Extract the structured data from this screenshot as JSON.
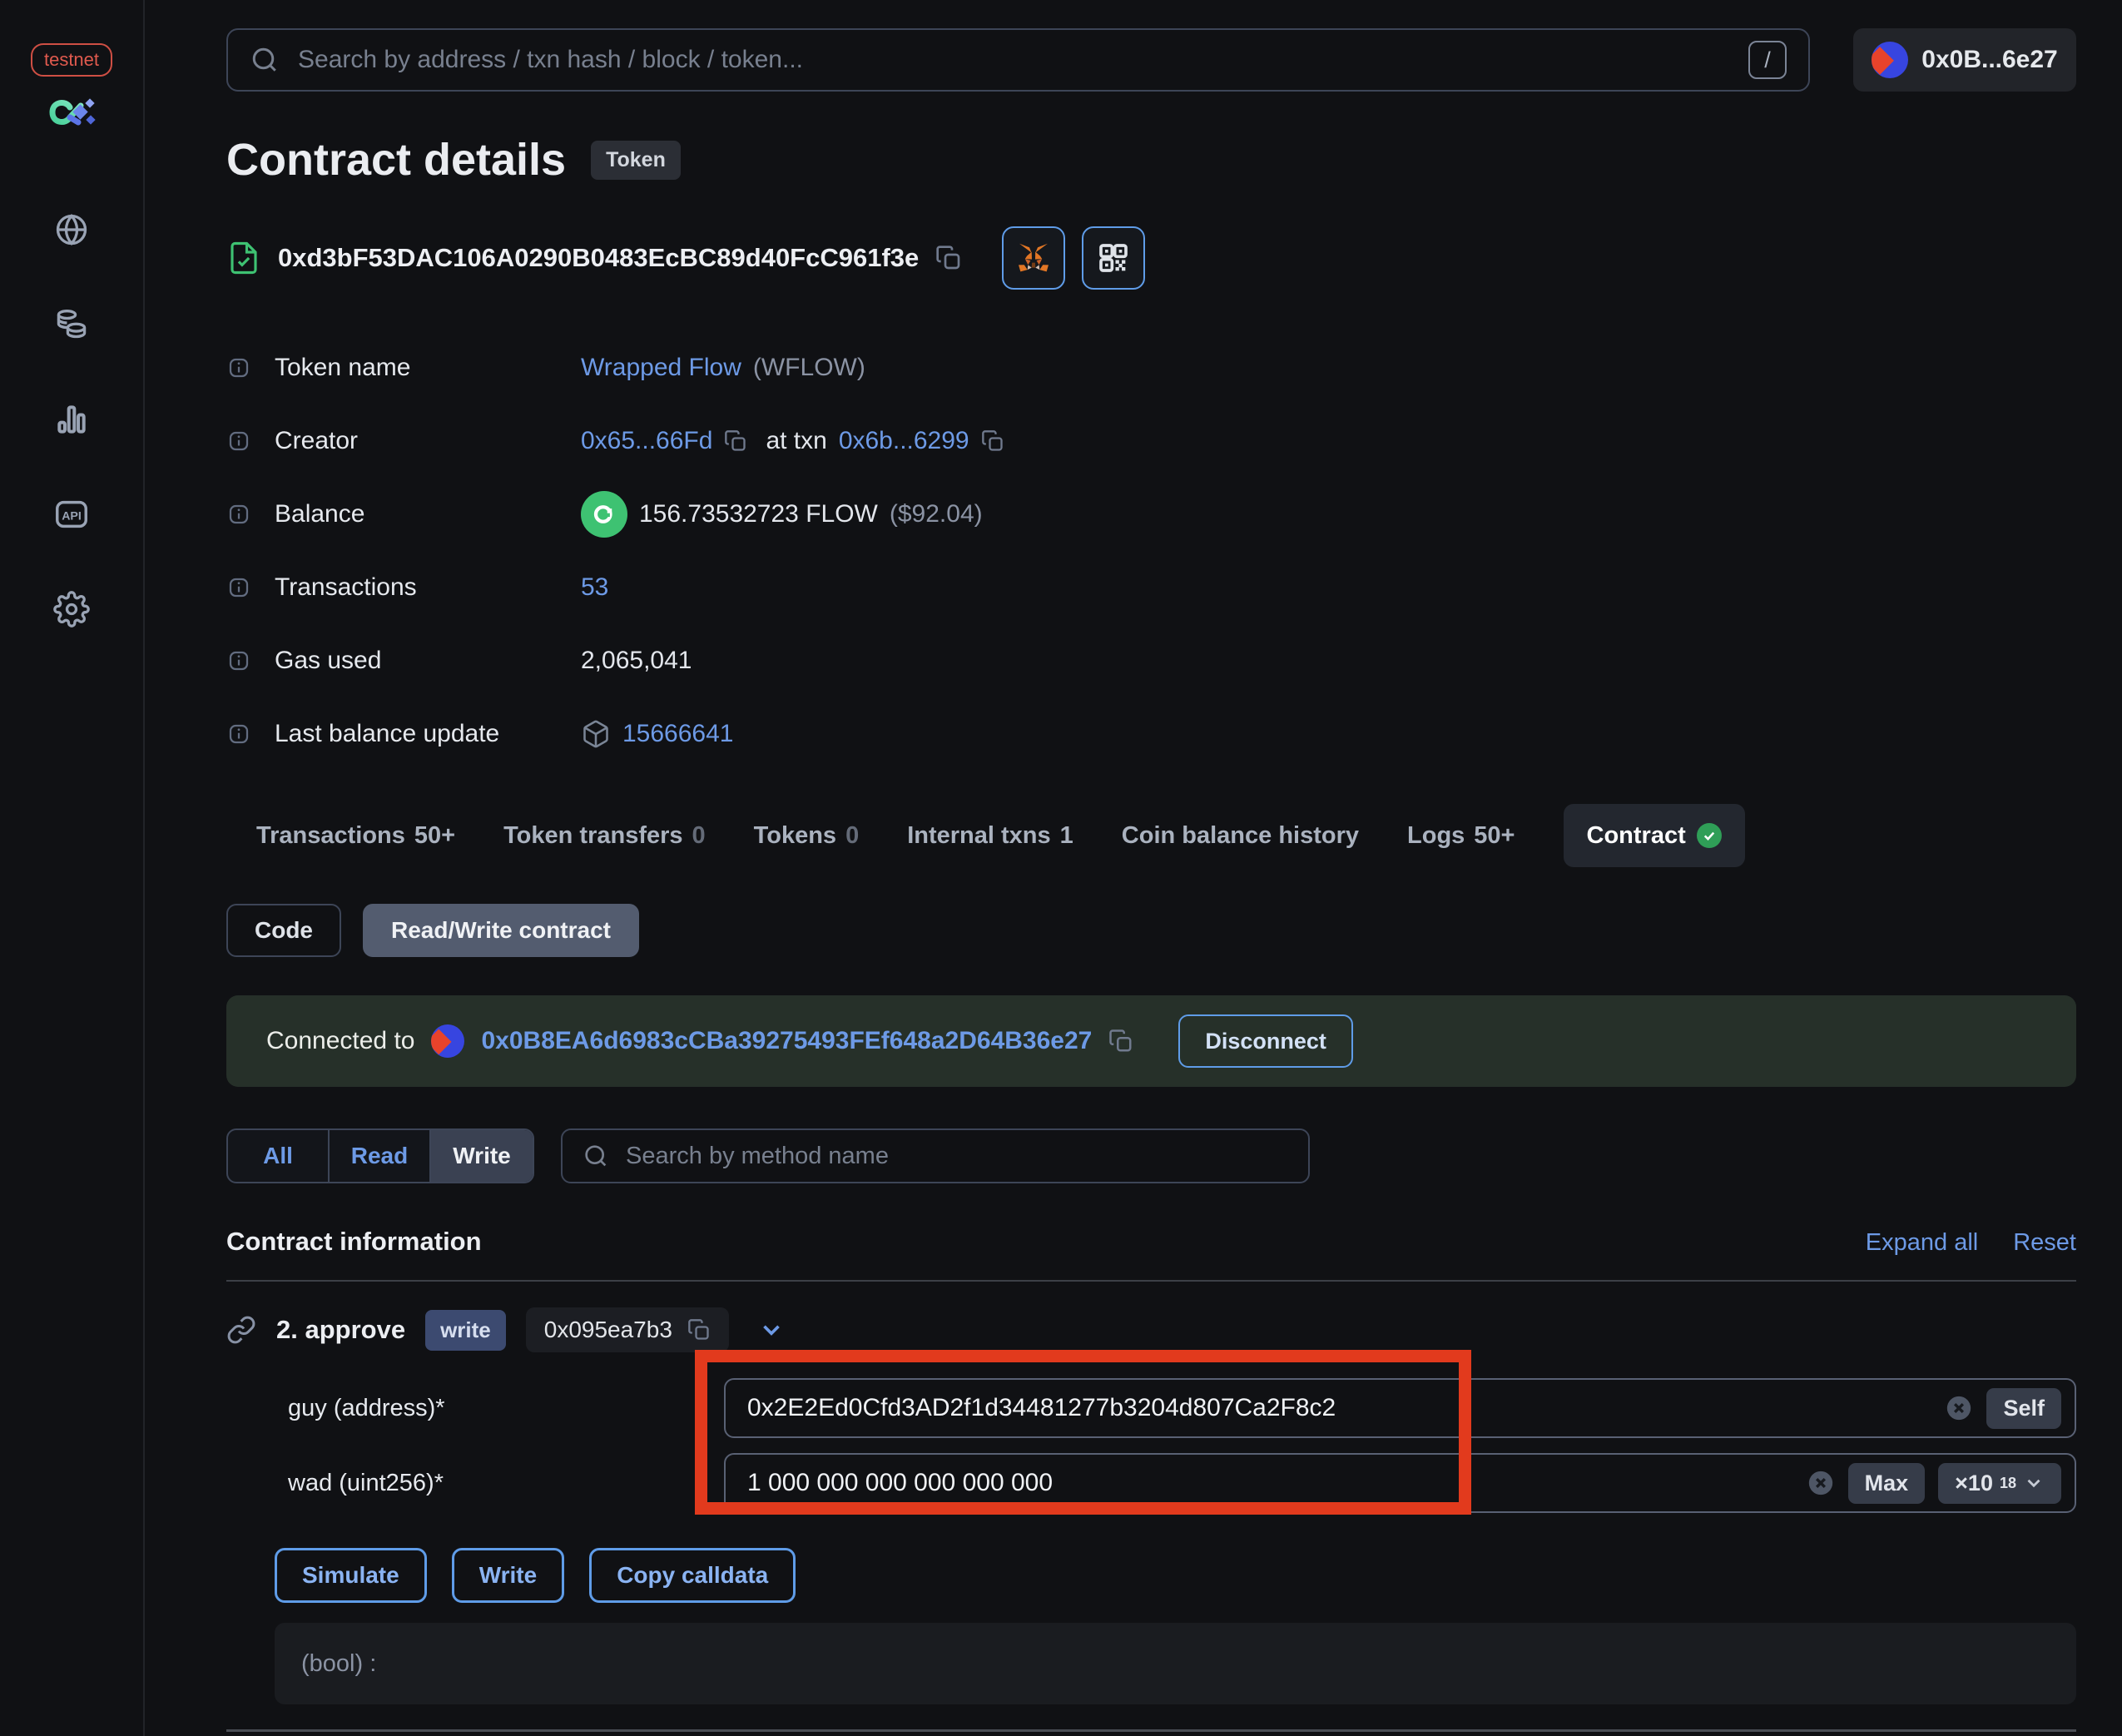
{
  "app": {
    "env_badge": "testnet"
  },
  "topbar": {
    "search_placeholder": "Search by address / txn hash / block / token...",
    "search_shortcut": "/",
    "wallet_address": "0x0B...6e27"
  },
  "header": {
    "title": "Contract details",
    "type_badge": "Token",
    "contract_address": "0xd3bF53DAC106A0290B0483EcBC89d40FcC961f3e"
  },
  "info": {
    "rows": [
      {
        "label": "Token name",
        "link": "Wrapped Flow",
        "suffix": "(WFLOW)"
      },
      {
        "label": "Creator",
        "creator": "0x65...66Fd",
        "mid": "at txn",
        "txn": "0x6b...6299"
      },
      {
        "label": "Balance",
        "value": "156.73532723 FLOW",
        "usd": "($92.04)"
      },
      {
        "label": "Transactions",
        "link": "53"
      },
      {
        "label": "Gas used",
        "value": "2,065,041"
      },
      {
        "label": "Last balance update",
        "link": "15666641"
      }
    ]
  },
  "tabs": [
    {
      "label": "Transactions",
      "count": "50+"
    },
    {
      "label": "Token transfers",
      "count": "0"
    },
    {
      "label": "Tokens",
      "count": "0"
    },
    {
      "label": "Internal txns",
      "count": "1"
    },
    {
      "label": "Coin balance history",
      "count": ""
    },
    {
      "label": "Logs",
      "count": "50+"
    },
    {
      "label": "Contract",
      "count": ""
    }
  ],
  "subtabs": {
    "code": "Code",
    "readwrite": "Read/Write contract"
  },
  "connection": {
    "prefix": "Connected to",
    "address": "0x0B8EA6d6983cCBa39275493FEf648a2D64B36e27",
    "disconnect": "Disconnect"
  },
  "methods_filter": {
    "all": "All",
    "read": "Read",
    "write": "Write",
    "search_placeholder": "Search by method name"
  },
  "section": {
    "title": "Contract information",
    "expand_all": "Expand all",
    "reset": "Reset"
  },
  "method": {
    "name": "2. approve",
    "kind_badge": "write",
    "selector": "0x095ea7b3",
    "params": [
      {
        "label": "guy (address)*",
        "value": "0x2E2Ed0Cfd3AD2f1d34481277b3204d807Ca2F8c2"
      },
      {
        "label": "wad (uint256)*",
        "value": "1 000 000 000 000 000 000"
      }
    ],
    "self_button": "Self",
    "max_button": "Max",
    "mult_base": "×10",
    "mult_exp": "18",
    "buttons": {
      "simulate": "Simulate",
      "write": "Write",
      "copy": "Copy calldata"
    },
    "output": "(bool) :"
  },
  "icons": {
    "search-icon": "magnifier",
    "globe-icon": "globe",
    "tokens-icon": "coin stacks",
    "stats-icon": "bar chart",
    "api-icon": "API in rounded square",
    "settings-icon": "gear",
    "contract-verified-icon": "green file with checkmark",
    "info-icon": "i in rounded square",
    "copy-icon": "overlapping squares",
    "metamask-icon": "fox head",
    "qr-icon": "qr code",
    "flow-token-icon": "flow logo in green circle",
    "block-icon": "cube",
    "link-icon": "chain link",
    "chevron-down-icon": "chevron down",
    "clear-icon": "x in filled circle",
    "verified-check-icon": "white check in green circle",
    "identicon": "blue circle with red diamond",
    "keyboard-shortcut": "slash key"
  },
  "colors": {
    "accent_blue": "#6d9ae6",
    "green": "#3ec272",
    "highlight_red": "#e23a1d",
    "testnet_red": "#e05a4e",
    "banner_green_bg": "#263029"
  }
}
